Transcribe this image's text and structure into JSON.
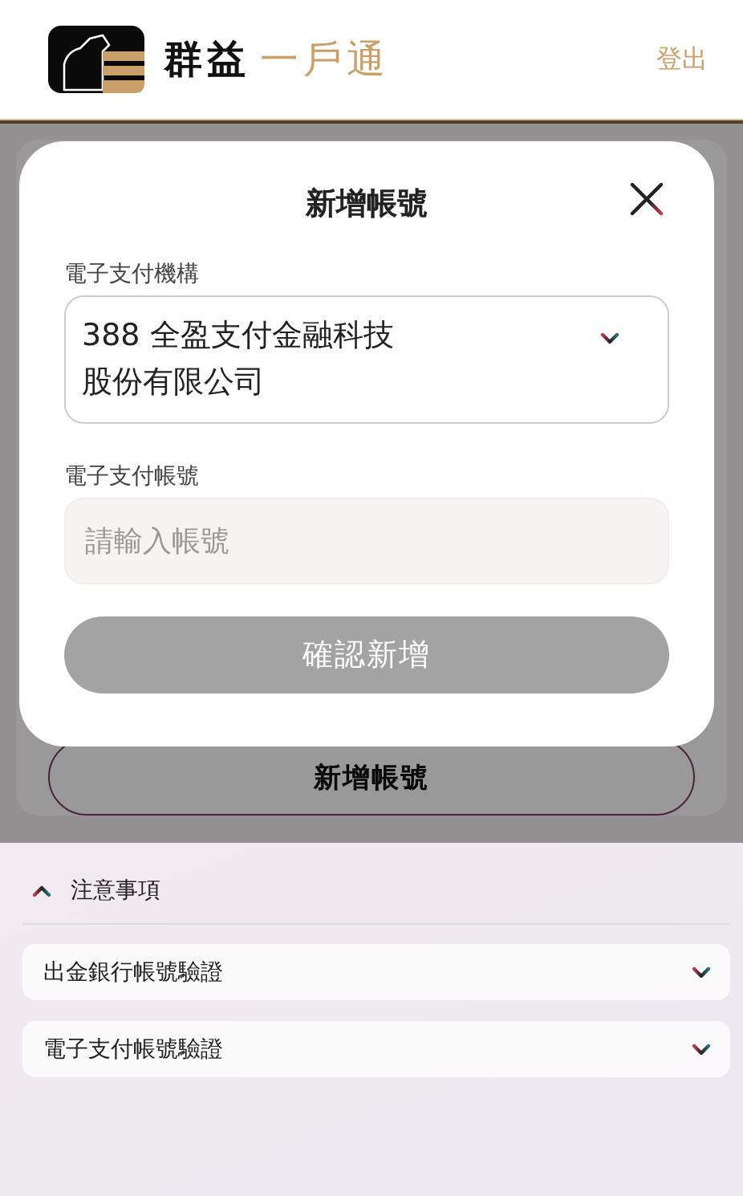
{
  "header": {
    "brand_primary": "群益",
    "brand_secondary": "一戶通",
    "logout": "登出"
  },
  "background_page": {
    "add_button": "新增帳號"
  },
  "modal": {
    "title": "新增帳號",
    "institution_label": "電子支付機構",
    "institution_lines": [
      "388 全盈支付金融科技",
      "股份有限公司"
    ],
    "account_label": "電子支付帳號",
    "account_placeholder": "請輸入帳號",
    "confirm_button": "確認新增",
    "confirm_disabled": true
  },
  "notes": {
    "title": "注意事項",
    "expanded": true,
    "items": [
      {
        "label": "出金銀行帳號驗證",
        "expanded": false
      },
      {
        "label": "電子支付帳號驗證",
        "expanded": false
      }
    ]
  }
}
